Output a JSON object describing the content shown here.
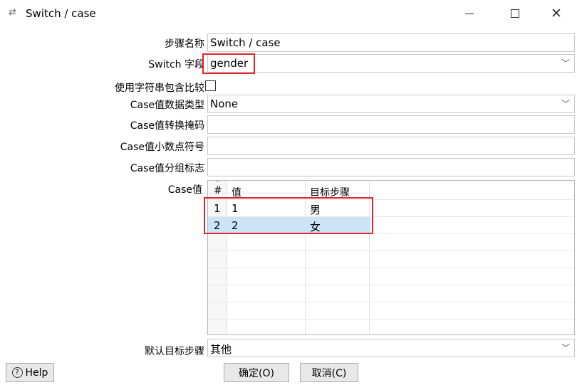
{
  "window": {
    "title": "Switch / case",
    "title_icon": "swap-arrows-icon"
  },
  "form": {
    "step_name_label": "步骤名称",
    "step_name_value": "Switch / case",
    "switch_field_label": "Switch 字段",
    "switch_field_value": "gender",
    "use_string_contains_label": "使用字符串包含比较",
    "case_data_type_label": "Case值数据类型",
    "case_data_type_value": "None",
    "case_mask_label": "Case值转换掩码",
    "case_mask_value": "",
    "case_decimal_label": "Case值小数点符号",
    "case_decimal_value": "",
    "case_grouping_label": "Case值分组标志",
    "case_grouping_value": "",
    "case_values_label": "Case值",
    "default_target_label": "默认目标步骤",
    "default_target_value": "其他"
  },
  "table": {
    "sort_glyph": "⌃",
    "headers": [
      "#",
      "值",
      "目标步骤"
    ],
    "rows": [
      {
        "num": "1",
        "value": "1",
        "target": "男",
        "selected": false
      },
      {
        "num": "2",
        "value": "2",
        "target": "女",
        "selected": true
      }
    ]
  },
  "buttons": {
    "help": "Help",
    "ok": "确定(O)",
    "cancel": "取消(C)"
  },
  "colors": {
    "highlight": "#e0242b",
    "selection": "#cce4f7"
  }
}
